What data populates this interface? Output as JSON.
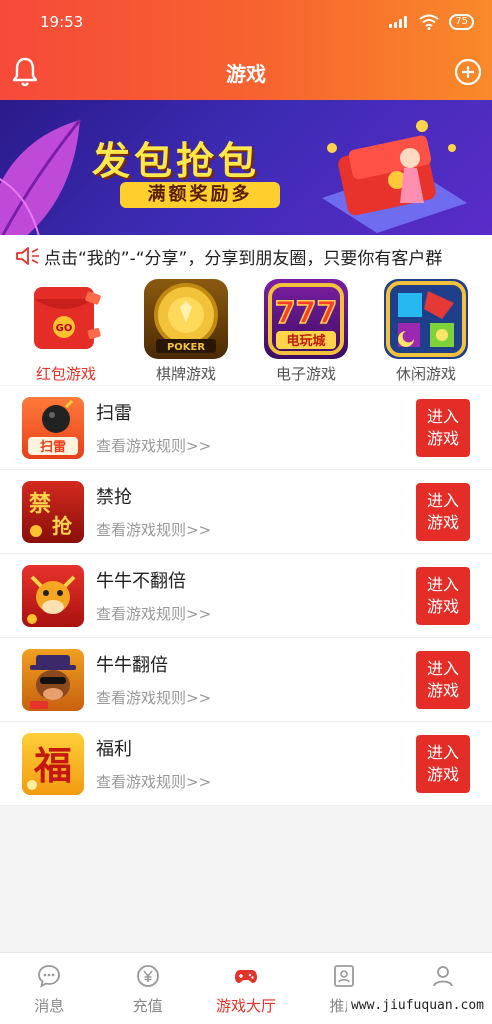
{
  "status": {
    "time": "19:53",
    "battery": "75"
  },
  "nav": {
    "title": "游戏"
  },
  "banner": {
    "title": "发包抢包",
    "subtitle": "满额奖励多"
  },
  "notice": {
    "text": "点击“我的”-“分享”，分享到朋友圈，只要你有客户群"
  },
  "categories": [
    {
      "label": "红包游戏",
      "icon": "red-envelope-icon",
      "color": "#e3332a"
    },
    {
      "label": "棋牌游戏",
      "icon": "poker-chip-icon",
      "img_text": "POKER"
    },
    {
      "label": "电子游戏",
      "icon": "slot-777-icon",
      "img_text": "电玩城"
    },
    {
      "label": "休闲游戏",
      "icon": "gem-puzzle-icon"
    }
  ],
  "games": [
    {
      "title": "扫雷",
      "rule": "查看游戏规则>>",
      "button": "进入游戏",
      "icon": "minesweeper-icon",
      "icon_text": "扫雷"
    },
    {
      "title": "禁抢",
      "rule": "查看游戏规则>>",
      "button": "进入游戏",
      "icon": "no-grab-icon",
      "icon_text": "禁抢"
    },
    {
      "title": "牛牛不翻倍",
      "rule": "查看游戏规则>>",
      "button": "进入游戏",
      "icon": "bull-icon"
    },
    {
      "title": "牛牛翻倍",
      "rule": "查看游戏规则>>",
      "button": "进入游戏",
      "icon": "bull-cowboy-icon"
    },
    {
      "title": "福利",
      "rule": "查看游戏规则>>",
      "button": "进入游戏",
      "icon": "fortune-icon",
      "icon_text": "福"
    }
  ],
  "tabs": [
    {
      "label": "消息",
      "icon": "chat-bubble-icon"
    },
    {
      "label": "充值",
      "icon": "yuan-coin-icon"
    },
    {
      "label": "游戏大厅",
      "icon": "gamepad-icon",
      "active": true
    },
    {
      "label": "推广",
      "icon": "id-card-icon"
    },
    {
      "label": "我的",
      "icon": "user-icon"
    }
  ],
  "watermark": "www.jiufuquan.com",
  "colors": {
    "primary": "#e3332a",
    "header_start": "#f64a3a",
    "header_end": "#f98a2a"
  }
}
